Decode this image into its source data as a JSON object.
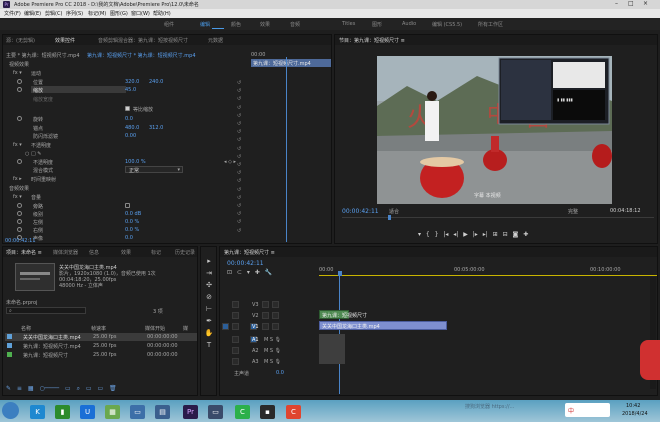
{
  "window": {
    "title": "Adobe Premiere Pro CC 2018 - D:\\我的文档\\Adobe\\Premiere Pro\\12.0\\未命名"
  },
  "menu": [
    "文件(F)",
    "编辑(E)",
    "剪辑(C)",
    "序列(S)",
    "标记(M)",
    "图形(G)",
    "窗口(W)",
    "帮助(H)"
  ],
  "workspaces": [
    {
      "label": "组件",
      "active": false
    },
    {
      "label": "编辑",
      "active": true
    },
    {
      "label": "颜色",
      "active": false
    },
    {
      "label": "效果",
      "active": false
    },
    {
      "label": "音频",
      "active": false
    },
    {
      "label": "Titles",
      "active": false
    },
    {
      "label": "图形",
      "active": false
    },
    {
      "label": "Audio",
      "active": false
    },
    {
      "label": "编辑 (CS5.5)",
      "active": false
    },
    {
      "label": "所有工作区",
      "active": false
    }
  ],
  "effect_panel": {
    "tabs": [
      "源：(无剪辑)",
      "效果控件",
      "音频剪辑混合器：第九课：短按视频尺寸",
      "元数据"
    ],
    "clip_path": "主要 * 第九课：短视频尺寸.mp4",
    "seq_path": "第九课：短视频尺寸 * 第九课：短视频尺寸.mp4",
    "timecode": "00:00",
    "section_video": "视频效果",
    "motion": "运动",
    "position_label": "位置",
    "position_x": "320.0",
    "position_y": "240.0",
    "scale_label": "缩放",
    "scale_value": "45.0",
    "scale_width_label": "缩放宽度",
    "uniform_label": "等比缩放",
    "rotation_label": "旋转",
    "rotation_value": "0.0",
    "anchor_label": "锚点",
    "anchor_x": "480.0",
    "anchor_y": "312.0",
    "flicker_label": "防闪烁滤镜",
    "flicker_value": "0.00",
    "opacity_section": "不透明度",
    "opacity_label": "不透明度",
    "opacity_value": "100.0 %",
    "blend_label": "混合模式",
    "blend_value": "正常",
    "time_remap": "时间重映射",
    "audio_section": "音频效果",
    "volume": "音量",
    "rows": [
      {
        "label": "旁路",
        "value": ""
      },
      {
        "label": "级别",
        "value": "0.0 dB"
      },
      {
        "label": "左侧",
        "value": "0.0 %"
      },
      {
        "label": "右侧",
        "value": "0.0 %"
      },
      {
        "label": "声像",
        "value": "0.0"
      }
    ],
    "bottom_timecode": "00:00:42:11",
    "clip_label": "第九课：短视频尺寸.mp4"
  },
  "program": {
    "title": "节目：第九课：短视频尺寸 ≡",
    "timecode": "00:00:42:11",
    "fit": "适合",
    "quality": "完整",
    "duration": "00:04:18:12",
    "subtitle": "字幕 本视频"
  },
  "project": {
    "tabs": [
      "项目：未命名 ≡",
      "媒体浏览器",
      "信息",
      "效果",
      "标记",
      "历史记录"
    ],
    "project_file": "未命名.prproj",
    "thumb_name": "关关中国龙海口主类.mp4",
    "thumb_info": "影片，1920x1080 (1.0)，音频已使用 1次",
    "thumb_dur": "00:04:18:20，25.00fps",
    "thumb_audio": "48000 Hz - 立体声",
    "item_count": "3 项",
    "col_name": "名称",
    "col_rate": "帧速率",
    "col_start": "媒体开始",
    "col_end": "媒",
    "items": [
      {
        "name": "关关中国龙海口主类.mp4",
        "rate": "25.00 fps",
        "start": "00:00:00:00"
      },
      {
        "name": "第九课：短视频尺寸.mp4",
        "rate": "25.00 fps",
        "start": "00:00:00:00"
      },
      {
        "name": "第九课：短视频尺寸",
        "rate": "25.00 fps",
        "start": "00:00:00:00"
      }
    ]
  },
  "timeline": {
    "title": "第九课：短视频尺寸 ≡",
    "timecode": "00:00:42:11",
    "ruler": [
      "00:00",
      "00:05:00:00",
      "00:10:00:00"
    ],
    "tracks": [
      "V3",
      "V2",
      "V1",
      "A1",
      "A2",
      "A3"
    ],
    "source_v": "V1",
    "source_a": "A1",
    "master": "主声道",
    "master_value": "0.0",
    "clip_v": "第九课：短视频尺寸",
    "clip_v2": "关关中国龙海口主类.mp4"
  },
  "taskbar": {
    "time": "10:42",
    "date": "2018/4/24",
    "watermark": "搜狗浏览器 https://...",
    "ime": "中"
  }
}
